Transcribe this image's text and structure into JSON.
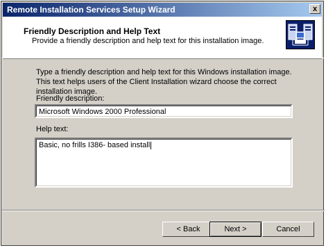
{
  "window": {
    "title": "Remote Installation Services Setup Wizard",
    "close_label": "x"
  },
  "header": {
    "title": "Friendly Description and Help Text",
    "subtitle": "Provide a friendly description and help text for this installation image.",
    "icon": "network-computers-icon"
  },
  "body": {
    "description": "Type a friendly description and help text for this Windows installation image. This text helps users of the Client Installation wizard choose the correct installation image.",
    "friendly_label": "Friendly description:",
    "friendly_value": "Microsoft Windows 2000 Professional",
    "help_label": "Help text:",
    "help_value": "Basic, no frills I386- based install"
  },
  "buttons": {
    "back": "< Back",
    "next": "Next >",
    "cancel": "Cancel"
  },
  "colors": {
    "titlebar_start": "#0a246a",
    "titlebar_end": "#a6caf0",
    "face": "#d4d0c8"
  }
}
